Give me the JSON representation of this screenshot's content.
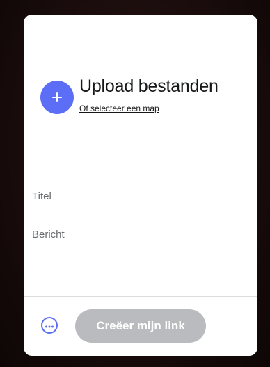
{
  "upload": {
    "title": "Upload bestanden",
    "folder_link": "Of selecteer een map",
    "add_icon": "plus-icon"
  },
  "form": {
    "title_placeholder": "Titel",
    "title_value": "",
    "message_placeholder": "Bericht",
    "message_value": ""
  },
  "footer": {
    "more_icon": "more-options-icon",
    "create_label": "Creëer mijn link",
    "create_disabled": true
  },
  "colors": {
    "accent": "#5b6ef5",
    "button_disabled": "#b9bbbe",
    "text": "#17181a",
    "placeholder": "#6a6d70",
    "divider": "#dcdcdc"
  }
}
